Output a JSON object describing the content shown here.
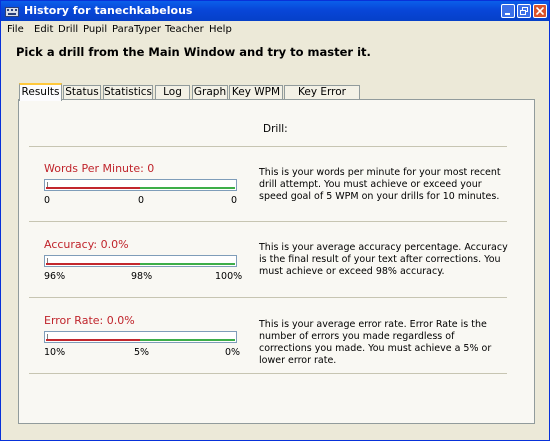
{
  "window": {
    "title": "History for tanechkabelous"
  },
  "menu": [
    "File",
    "Edit",
    "Drill",
    "Pupil",
    "ParaTyper",
    "Teacher",
    "Help"
  ],
  "instruction": "Pick a drill from the Main Window and try to master it.",
  "tabs": [
    "Results",
    "Status",
    "Statistics",
    "Log",
    "Graph",
    "Key WPM",
    "Key Error Rate"
  ],
  "active_tab": "Results",
  "drill_label": "Drill:",
  "metrics": [
    {
      "label": "Words Per Minute: 0",
      "ticks": [
        "0",
        "0",
        "0"
      ],
      "description": "This is your words per minute for your most recent drill attempt. You must achieve or exceed your speed goal of 5 WPM on your drills for 10 minutes."
    },
    {
      "label": "Accuracy: 0.0%",
      "ticks": [
        "96%",
        "98%",
        "100%"
      ],
      "description": "This is your average accuracy percentage. Accuracy is the final result of your text after corrections. You must achieve or exceed 98% accuracy."
    },
    {
      "label": "Error Rate: 0.0%",
      "ticks": [
        "10%",
        "5%",
        "0%"
      ],
      "description": "This is your average error rate. Error Rate is the number of errors you made regardless of corrections you made. You must achieve a 5% or lower error rate."
    }
  ],
  "colors": {
    "title_bar": "#0A5FEA",
    "label_red": "#C0252C",
    "bar_red": "#C2272D",
    "bar_green": "#3DAE49",
    "active_tab_accent": "#FFC83C"
  },
  "icons": {
    "app": "keyboard-icon",
    "minimize": "minimize-icon",
    "restore": "restore-icon",
    "close": "close-icon"
  }
}
